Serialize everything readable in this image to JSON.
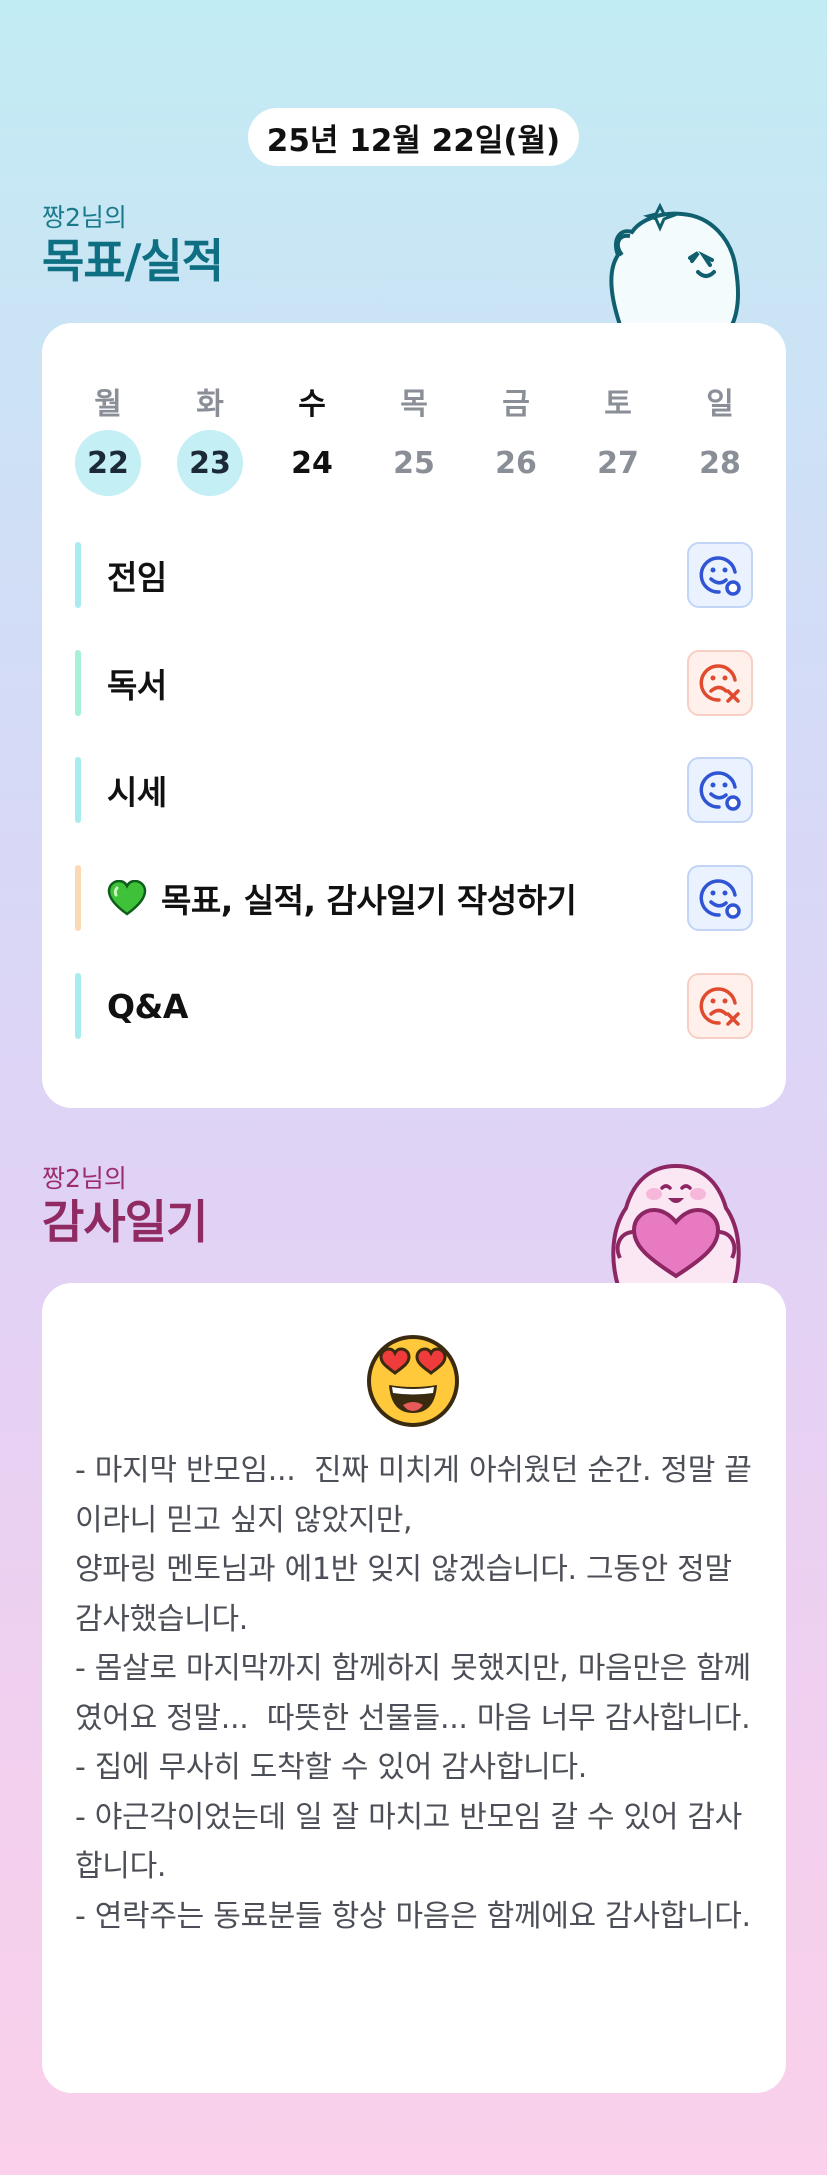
{
  "date_label": "25년 12월 22일(월)",
  "goals_section": {
    "subtitle": "짱2님의",
    "title": "목표/실적"
  },
  "week": {
    "days": [
      {
        "weekday": "월",
        "date": "22",
        "state": "done"
      },
      {
        "weekday": "화",
        "date": "23",
        "state": "done"
      },
      {
        "weekday": "수",
        "date": "24",
        "state": "today"
      },
      {
        "weekday": "목",
        "date": "25",
        "state": "future"
      },
      {
        "weekday": "금",
        "date": "26",
        "state": "future"
      },
      {
        "weekday": "토",
        "date": "27",
        "state": "future"
      },
      {
        "weekday": "일",
        "date": "28",
        "state": "future"
      }
    ]
  },
  "goals": [
    {
      "label": "전임",
      "status": "achieved",
      "bar_color": "#a8ecf0",
      "icon": "smile-check-icon"
    },
    {
      "label": "독서",
      "status": "missed",
      "bar_color": "#a8f0d8",
      "icon": "frown-x-icon"
    },
    {
      "label": "시세",
      "status": "achieved",
      "bar_color": "#a8ecf0",
      "icon": "smile-check-icon"
    },
    {
      "label": "목표, 실적, 감사일기 작성하기",
      "status": "achieved",
      "bar_color": "#fbd9b5",
      "icon": "smile-check-icon",
      "prefix_icon": "green-heart-icon"
    },
    {
      "label": "Q&A",
      "status": "missed",
      "bar_color": "#a8ecf0",
      "icon": "frown-x-icon"
    }
  ],
  "gratitude_section": {
    "subtitle": "짱2님의",
    "title": "감사일기"
  },
  "gratitude": {
    "mood_icon": "heart-eyes-face-icon",
    "text": "- 마지막 반모임...  진짜 미치게 아쉬웠던 순간. 정말 끝이라니 믿고 싶지 않았지만,\n양파링 멘토님과 에1반 잊지 않겠습니다. 그동안 정말 감사했습니다.\n- 몸살로 마지막까지 함께하지 못했지만, 마음만은 함께였어요 정말...  따뜻한 선물들... 마음 너무 감사합니다.\n- 집에 무사히 도착할 수 있어 감사합니다.\n- 야근각이었는데 일 잘 마치고 반모임 갈 수 있어 감사합니다.\n- 연락주는 동료분들 항상 마음은 함께에요 감사합니다."
  },
  "colors": {
    "achieved": "#2f55d4",
    "missed": "#e04b2f",
    "done_day_bg": "#c3eff5"
  }
}
